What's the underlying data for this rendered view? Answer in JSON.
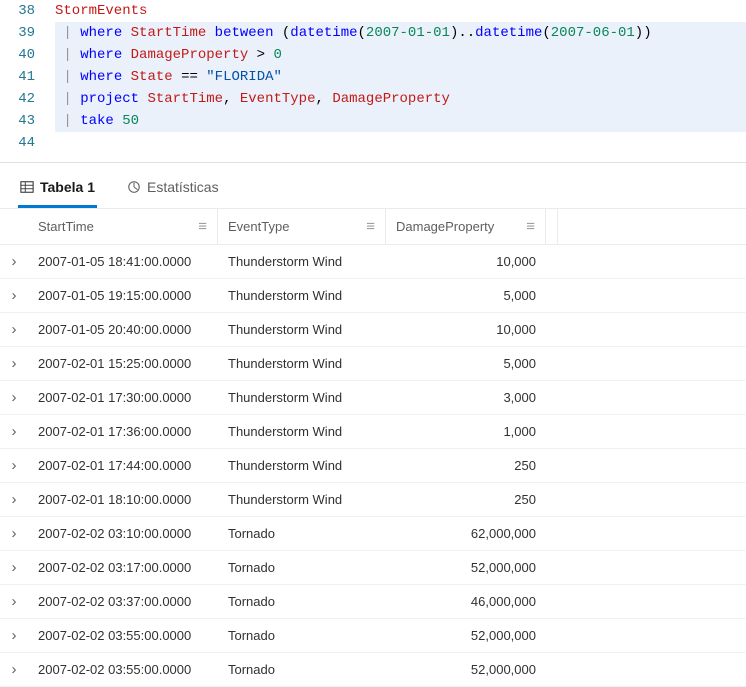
{
  "editor": {
    "lines": [
      {
        "number": "38",
        "highlighted": false,
        "tokens": [
          {
            "text": "StormEvents",
            "class": "tk-ident"
          }
        ]
      },
      {
        "number": "39",
        "highlighted": true,
        "tokens": [
          {
            "text": " ",
            "class": ""
          },
          {
            "text": "|",
            "class": "tk-pipe"
          },
          {
            "text": " ",
            "class": ""
          },
          {
            "text": "where",
            "class": "tk-keyword"
          },
          {
            "text": " ",
            "class": ""
          },
          {
            "text": "StartTime",
            "class": "tk-ident"
          },
          {
            "text": " ",
            "class": ""
          },
          {
            "text": "between",
            "class": "tk-keyword"
          },
          {
            "text": " (",
            "class": "tk-punct"
          },
          {
            "text": "datetime",
            "class": "tk-func"
          },
          {
            "text": "(",
            "class": "tk-punct"
          },
          {
            "text": "2007-01-01",
            "class": "tk-number"
          },
          {
            "text": ")..",
            "class": "tk-punct"
          },
          {
            "text": "datetime",
            "class": "tk-func"
          },
          {
            "text": "(",
            "class": "tk-punct"
          },
          {
            "text": "2007-06-01",
            "class": "tk-number"
          },
          {
            "text": "))",
            "class": "tk-punct"
          }
        ]
      },
      {
        "number": "40",
        "highlighted": true,
        "tokens": [
          {
            "text": " ",
            "class": ""
          },
          {
            "text": "|",
            "class": "tk-pipe"
          },
          {
            "text": " ",
            "class": ""
          },
          {
            "text": "where",
            "class": "tk-keyword"
          },
          {
            "text": " ",
            "class": ""
          },
          {
            "text": "DamageProperty",
            "class": "tk-ident"
          },
          {
            "text": " ",
            "class": ""
          },
          {
            "text": ">",
            "class": "tk-op"
          },
          {
            "text": " ",
            "class": ""
          },
          {
            "text": "0",
            "class": "tk-number"
          }
        ]
      },
      {
        "number": "41",
        "highlighted": true,
        "tokens": [
          {
            "text": " ",
            "class": ""
          },
          {
            "text": "|",
            "class": "tk-pipe"
          },
          {
            "text": " ",
            "class": ""
          },
          {
            "text": "where",
            "class": "tk-keyword"
          },
          {
            "text": " ",
            "class": ""
          },
          {
            "text": "State",
            "class": "tk-ident"
          },
          {
            "text": " ",
            "class": ""
          },
          {
            "text": "==",
            "class": "tk-op"
          },
          {
            "text": " ",
            "class": ""
          },
          {
            "text": "\"FLORIDA\"",
            "class": "tk-string"
          }
        ]
      },
      {
        "number": "42",
        "highlighted": true,
        "tokens": [
          {
            "text": " ",
            "class": ""
          },
          {
            "text": "|",
            "class": "tk-pipe"
          },
          {
            "text": " ",
            "class": ""
          },
          {
            "text": "project",
            "class": "tk-keyword"
          },
          {
            "text": " ",
            "class": ""
          },
          {
            "text": "StartTime",
            "class": "tk-ident"
          },
          {
            "text": ", ",
            "class": "tk-punct"
          },
          {
            "text": "EventType",
            "class": "tk-ident"
          },
          {
            "text": ", ",
            "class": "tk-punct"
          },
          {
            "text": "DamageProperty",
            "class": "tk-ident"
          }
        ]
      },
      {
        "number": "43",
        "highlighted": true,
        "tokens": [
          {
            "text": " ",
            "class": ""
          },
          {
            "text": "|",
            "class": "tk-pipe"
          },
          {
            "text": " ",
            "class": ""
          },
          {
            "text": "take",
            "class": "tk-keyword"
          },
          {
            "text": " ",
            "class": ""
          },
          {
            "text": "50",
            "class": "tk-number"
          }
        ]
      },
      {
        "number": "44",
        "highlighted": false,
        "tokens": []
      }
    ]
  },
  "tabs": {
    "table_label": "Tabela 1",
    "stats_label": "Estatísticas"
  },
  "grid": {
    "columns": {
      "start": "StartTime",
      "event": "EventType",
      "damage": "DamageProperty"
    },
    "menu_glyph": "≡",
    "expand_glyph": "›",
    "rows": [
      {
        "start": "2007-01-05 18:41:00.0000",
        "event": "Thunderstorm Wind",
        "damage": "10,000"
      },
      {
        "start": "2007-01-05 19:15:00.0000",
        "event": "Thunderstorm Wind",
        "damage": "5,000"
      },
      {
        "start": "2007-01-05 20:40:00.0000",
        "event": "Thunderstorm Wind",
        "damage": "10,000"
      },
      {
        "start": "2007-02-01 15:25:00.0000",
        "event": "Thunderstorm Wind",
        "damage": "5,000"
      },
      {
        "start": "2007-02-01 17:30:00.0000",
        "event": "Thunderstorm Wind",
        "damage": "3,000"
      },
      {
        "start": "2007-02-01 17:36:00.0000",
        "event": "Thunderstorm Wind",
        "damage": "1,000"
      },
      {
        "start": "2007-02-01 17:44:00.0000",
        "event": "Thunderstorm Wind",
        "damage": "250"
      },
      {
        "start": "2007-02-01 18:10:00.0000",
        "event": "Thunderstorm Wind",
        "damage": "250"
      },
      {
        "start": "2007-02-02 03:10:00.0000",
        "event": "Tornado",
        "damage": "62,000,000"
      },
      {
        "start": "2007-02-02 03:17:00.0000",
        "event": "Tornado",
        "damage": "52,000,000"
      },
      {
        "start": "2007-02-02 03:37:00.0000",
        "event": "Tornado",
        "damage": "46,000,000"
      },
      {
        "start": "2007-02-02 03:55:00.0000",
        "event": "Tornado",
        "damage": "52,000,000"
      },
      {
        "start": "2007-02-02 03:55:00.0000",
        "event": "Tornado",
        "damage": "52,000,000"
      }
    ]
  }
}
